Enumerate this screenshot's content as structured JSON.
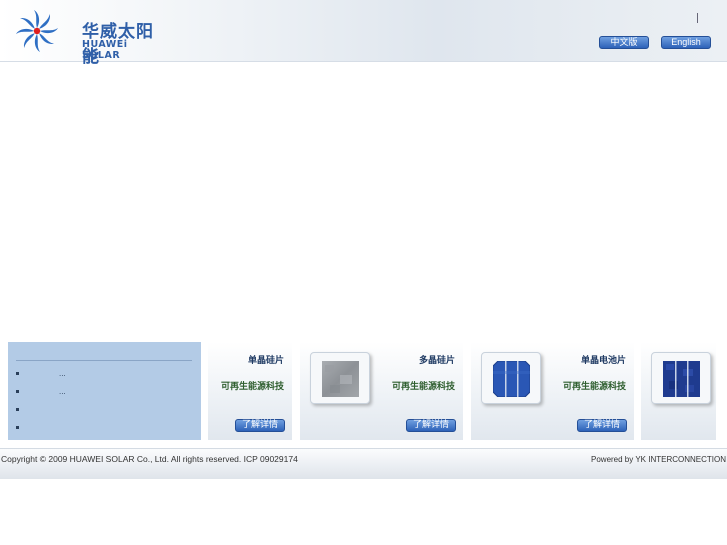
{
  "header": {
    "logo_cn": "华威太阳能",
    "logo_en": "HUAWEi SOLAR",
    "divider": "|",
    "lang_cn": "中文版",
    "lang_en": "English",
    "accent_color": "#2d62b8"
  },
  "news": {
    "items": [
      {
        "text": "..."
      },
      {
        "text": "..."
      },
      {
        "text": ""
      },
      {
        "text": ""
      }
    ]
  },
  "products": [
    {
      "title": "单晶硅片",
      "subtitle": "可再生能源科技",
      "button": "了解详情",
      "thumb_icon": "none"
    },
    {
      "title": "多晶硅片",
      "subtitle": "可再生能源科技",
      "button": "了解详情",
      "thumb_icon": "multicrystalline-wafer-icon"
    },
    {
      "title": "单晶电池片",
      "subtitle": "可再生能源科技",
      "button": "了解详情",
      "thumb_icon": "mono-solar-cell-icon"
    },
    {
      "title": "",
      "subtitle": "",
      "button": "",
      "thumb_icon": "poly-solar-cell-icon"
    }
  ],
  "footer": {
    "copyright": "Copyright © 2009 HUAWEI SOLAR Co., Ltd. All rights reserved.  ICP 09029174",
    "powered_by": "Powered by YK INTERCONNECTION"
  }
}
